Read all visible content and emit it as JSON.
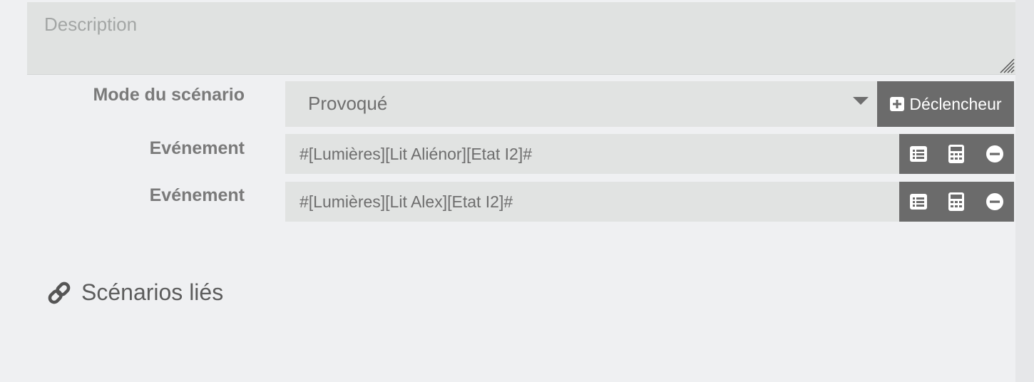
{
  "description": {
    "placeholder": "Description"
  },
  "mode": {
    "label": "Mode du scénario",
    "value": "Provoqué",
    "add_trigger_label": "Déclencheur"
  },
  "events": [
    {
      "label": "Evénement",
      "value": "#[Lumières][Lit Aliénor][Etat I2]#"
    },
    {
      "label": "Evénement",
      "value": "#[Lumières][Lit Alex][Etat I2]#"
    }
  ],
  "linked": {
    "title": "Scénarios liés"
  },
  "icons": {
    "add": "plus-square-icon",
    "list": "list-icon",
    "calculator": "calculator-icon",
    "remove": "minus-circle-icon",
    "link": "link-icon"
  },
  "colors": {
    "page_bg": "#eff0f2",
    "field_bg": "#e1e3e2",
    "button_bg": "#6b6b6b",
    "label_text": "#7a7a7a"
  }
}
